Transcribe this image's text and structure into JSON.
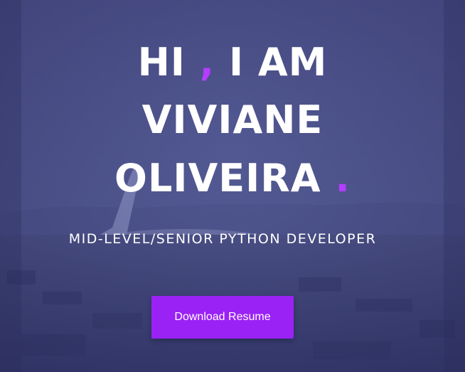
{
  "hero": {
    "greeting": "HI",
    "comma": ",",
    "i_am": "I AM",
    "first_name": "VIVIANE",
    "last_name": "OLIVEIRA",
    "period": ".",
    "subtitle": "MID-LEVEL/SENIOR PYTHON DEVELOPER",
    "download_button_label": "Download Resume"
  },
  "colors": {
    "accent": "#b43dff",
    "button": "#9b22f5",
    "overlay": "#4a4f86",
    "text": "#ffffff"
  }
}
